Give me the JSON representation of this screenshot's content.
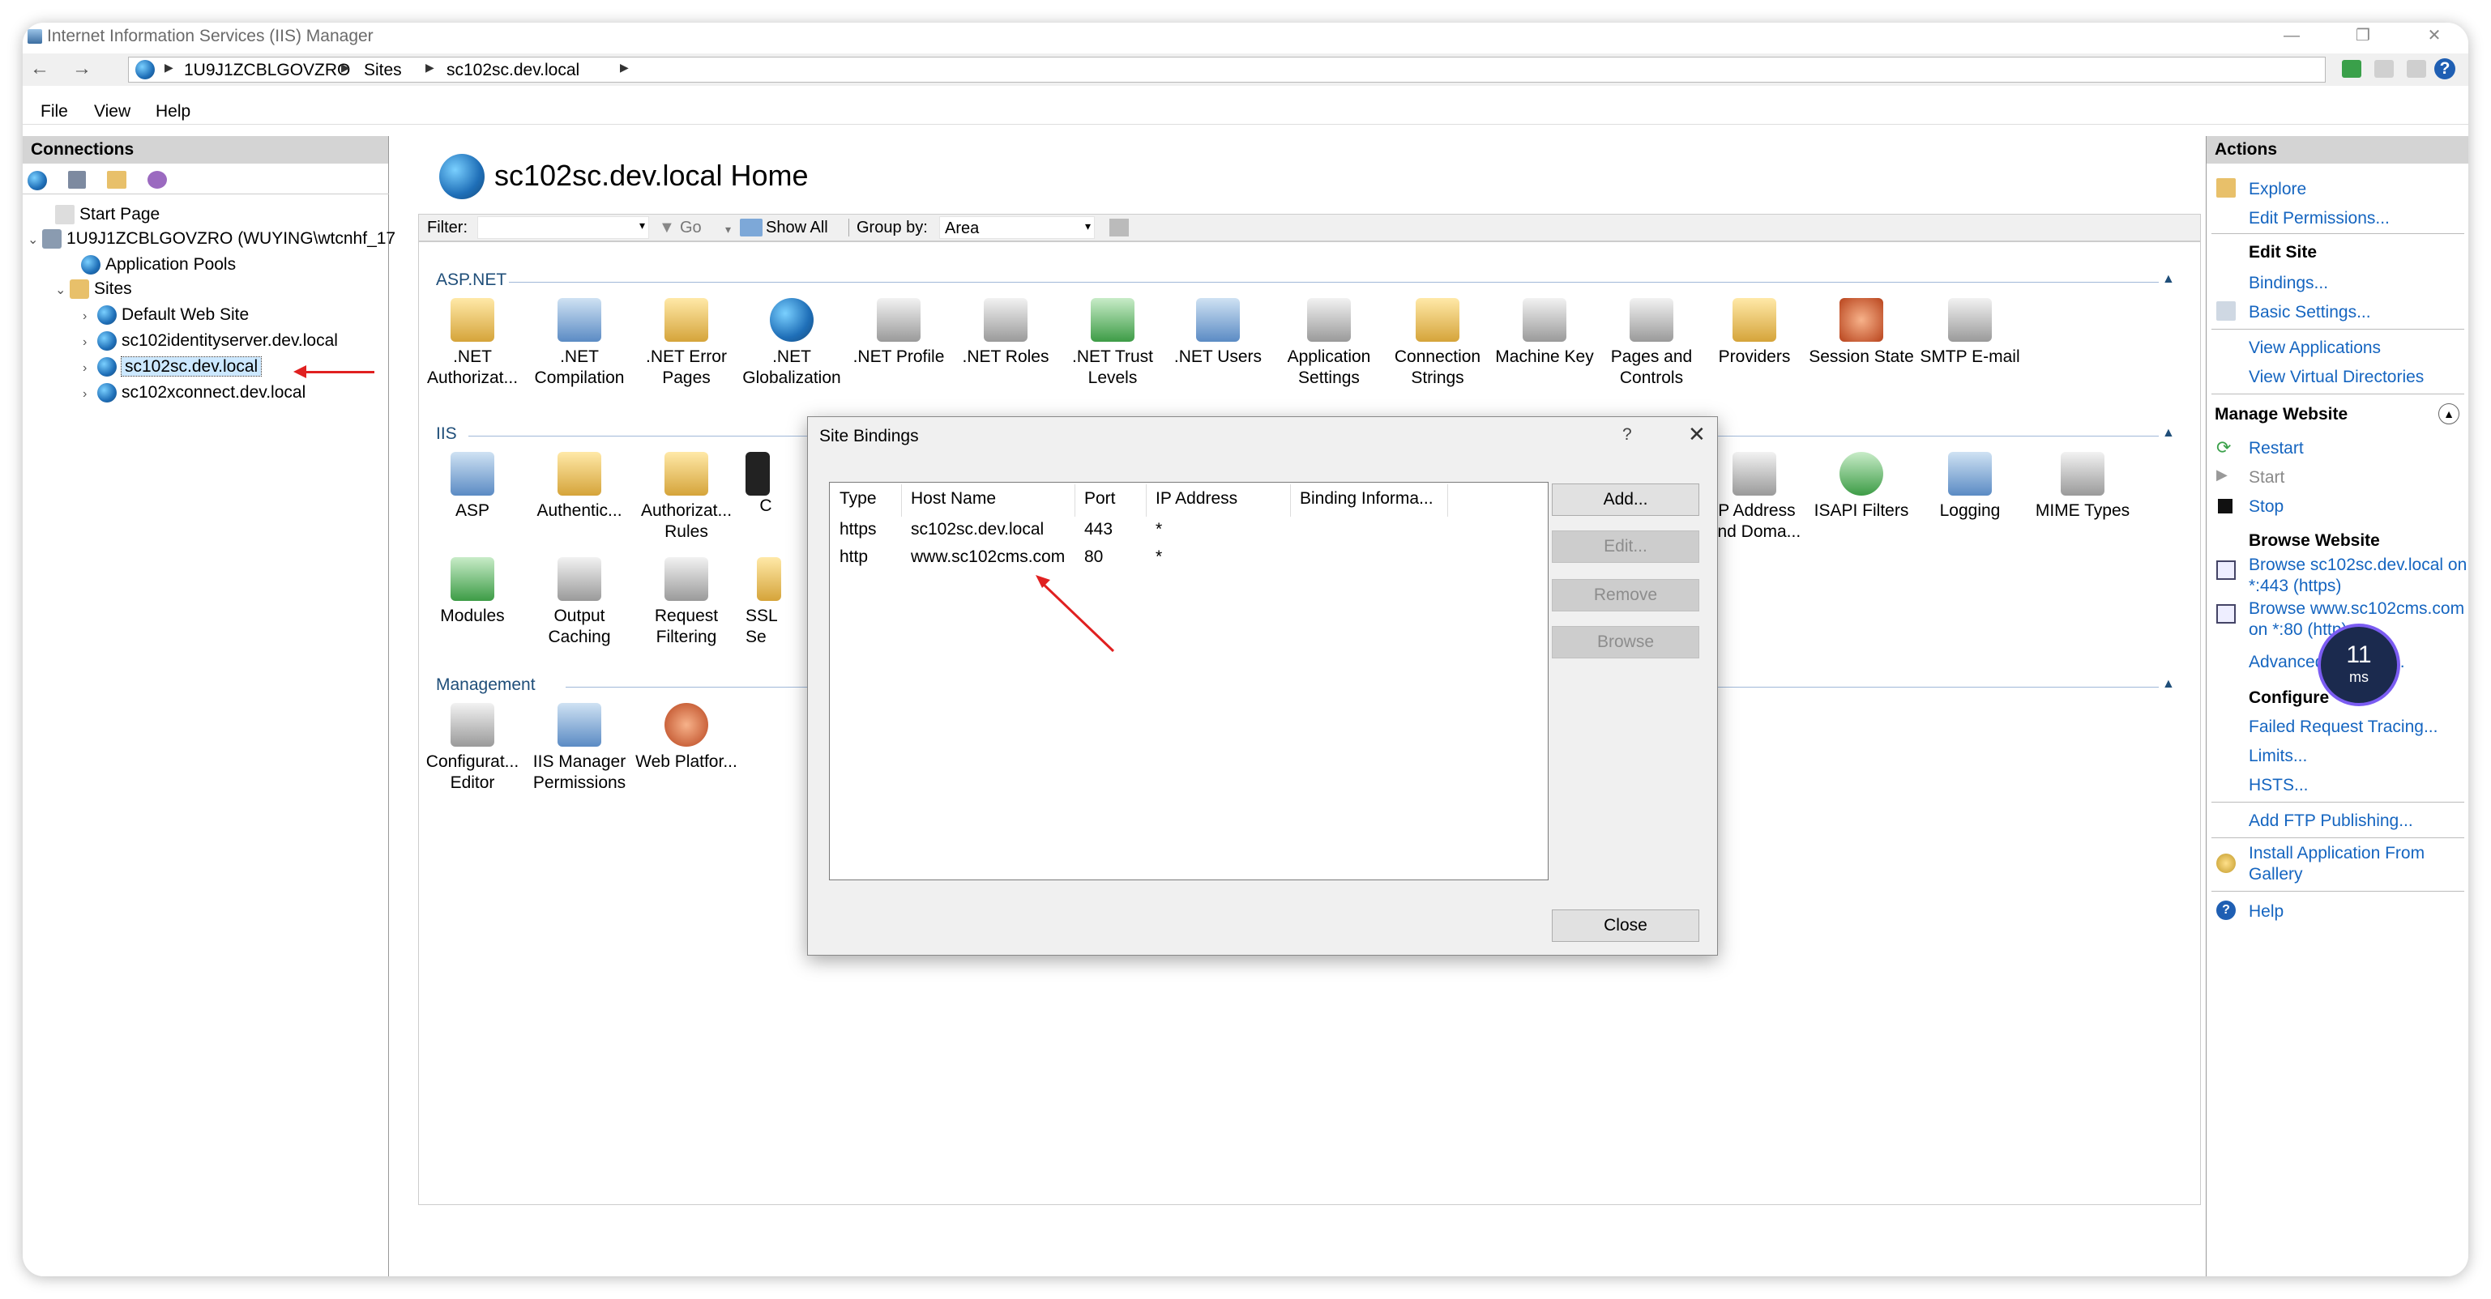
{
  "window": {
    "title": "Internet Information Services (IIS) Manager",
    "minimize": "—",
    "restore": "❐",
    "close": "✕"
  },
  "address": {
    "back": "←",
    "forward": "→",
    "crumbs": [
      "1U9J1ZCBLGOVZRO",
      "Sites",
      "sc102sc.dev.local"
    ],
    "sep": "▶",
    "help": "?"
  },
  "menu": {
    "file": "File",
    "view": "View",
    "help": "Help"
  },
  "connections": {
    "header": "Connections",
    "tree": {
      "start_page": "Start Page",
      "server": "1U9J1ZCBLGOVZRO (WUYING\\wtcnhf_17",
      "app_pools": "Application Pools",
      "sites": "Sites",
      "site_items": [
        "Default Web Site",
        "sc102identityserver.dev.local",
        "sc102sc.dev.local",
        "sc102xconnect.dev.local"
      ]
    }
  },
  "main": {
    "title": "sc102sc.dev.local Home",
    "filter": {
      "label": "Filter:",
      "go": "Go",
      "show_all": "Show All",
      "group_by_label": "Group by:",
      "group_by_value": "Area"
    },
    "groups": {
      "aspnet": "ASP.NET",
      "iis": "IIS",
      "management": "Management"
    },
    "aspnet_features": [
      ".NET Authorizat...",
      ".NET Compilation",
      ".NET Error Pages",
      ".NET Globalization",
      ".NET Profile",
      ".NET Roles",
      ".NET Trust Levels",
      ".NET Users",
      "Application Settings",
      "Connection Strings",
      "Machine Key",
      "Pages and Controls",
      "Providers",
      "Session State",
      "SMTP E-mail"
    ],
    "iis_features_row1": [
      "ASP",
      "Authentic...",
      "Authorizat... Rules",
      "C"
    ],
    "iis_features_row1_right": [
      "IP Address and Doma...",
      "ISAPI Filters",
      "Logging",
      "MIME Types"
    ],
    "iis_features_row2": [
      "Modules",
      "Output Caching",
      "Request Filtering",
      "SSL Se"
    ],
    "management_features": [
      "Configurat... Editor",
      "IIS Manager Permissions",
      "Web Platfor..."
    ]
  },
  "dialog": {
    "title": "Site Bindings",
    "help": "?",
    "close_x": "✕",
    "columns": [
      "Type",
      "Host Name",
      "Port",
      "IP Address",
      "Binding Informa..."
    ],
    "rows": [
      {
        "type": "https",
        "host": "sc102sc.dev.local",
        "port": "443",
        "ip": "*"
      },
      {
        "type": "http",
        "host": "www.sc102cms.com",
        "port": "80",
        "ip": "*"
      }
    ],
    "buttons": {
      "add": "Add...",
      "edit": "Edit...",
      "remove": "Remove",
      "browse": "Browse",
      "close": "Close"
    }
  },
  "actions": {
    "header": "Actions",
    "explore": "Explore",
    "edit_permissions": "Edit Permissions...",
    "edit_site": "Edit Site",
    "bindings": "Bindings...",
    "basic_settings": "Basic Settings...",
    "view_applications": "View Applications",
    "view_virtual_directories": "View Virtual Directories",
    "manage_website": "Manage Website",
    "restart": "Restart",
    "start": "Start",
    "stop": "Stop",
    "browse_website": "Browse Website",
    "browse_https_1": "Browse sc102sc.dev.local on",
    "browse_https_2": "*:443 (https)",
    "browse_http_1": "Browse www.sc102cms.com",
    "browse_http_2": "on *:80 (http)",
    "advanced": "Advanced Settings...",
    "configure": "Configure",
    "failed_request_tracing": "Failed Request Tracing...",
    "limits": "Limits...",
    "hsts": "HSTS...",
    "add_ftp": "Add FTP Publishing...",
    "install_app_1": "Install Application From",
    "install_app_2": "Gallery",
    "help": "Help"
  },
  "overlay": {
    "timer_value": "11",
    "timer_unit": "ms"
  },
  "colors": {
    "link": "#1565c0",
    "pane_header": "#d4d4d4",
    "annotation": "#e02020",
    "timer_ring": "#7b5cf2"
  }
}
